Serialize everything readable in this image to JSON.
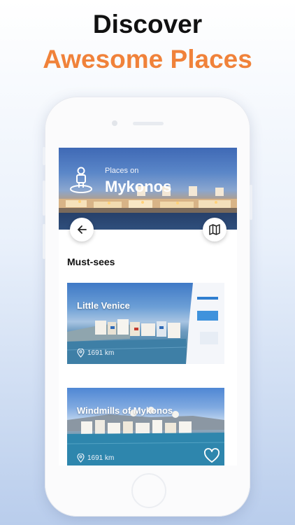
{
  "hero": {
    "line1": "Discover",
    "line2": "Awesome Places",
    "accent_color": "#f0823a"
  },
  "header": {
    "subtitle": "Places on",
    "title": "Mykonos",
    "icon": "location-person-icon"
  },
  "nav": {
    "back_icon": "arrow-left-icon",
    "map_icon": "map-icon"
  },
  "section": {
    "title": "Must-sees"
  },
  "places": [
    {
      "name": "Little Venice",
      "distance": "1691 km",
      "distance_icon": "location-pin-icon",
      "favorite_icon": "heart-icon"
    },
    {
      "name": "Windmills of Mykonos",
      "distance": "1691 km",
      "distance_icon": "location-pin-icon",
      "favorite_icon": "heart-icon"
    }
  ]
}
